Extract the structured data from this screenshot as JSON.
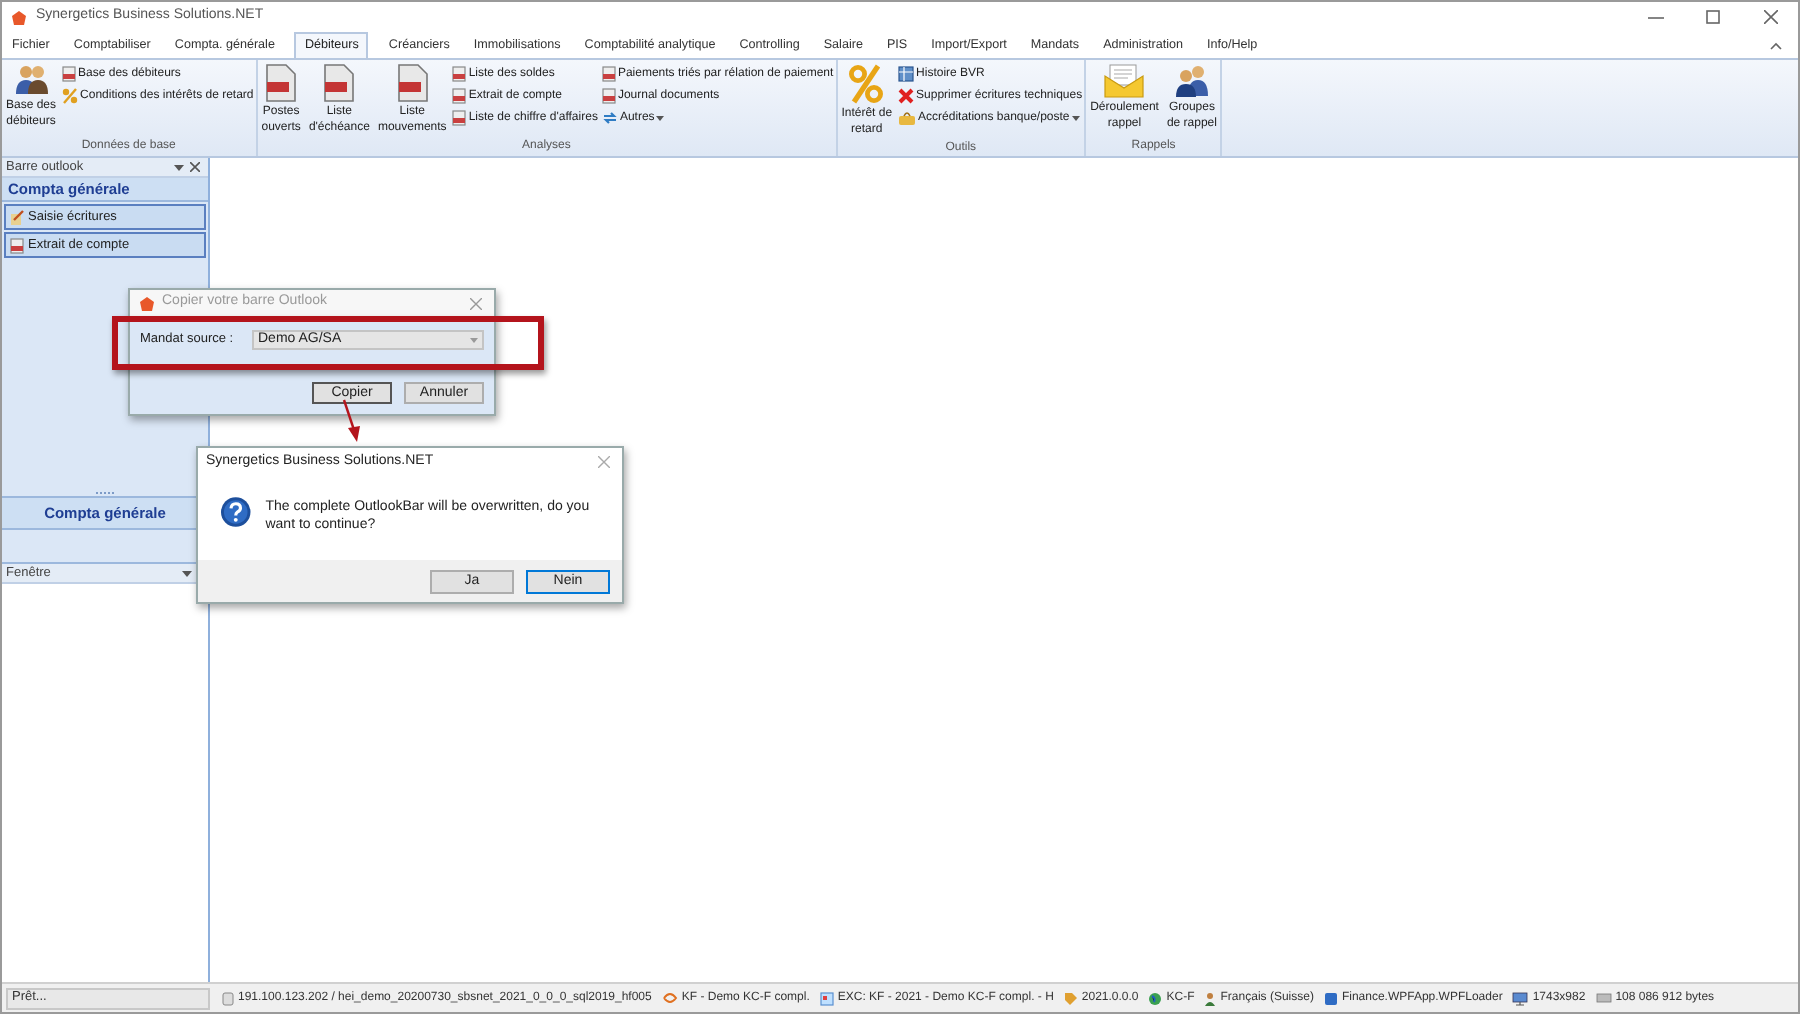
{
  "window": {
    "title": "Synergetics Business Solutions.NET"
  },
  "tabs": [
    {
      "label": "Fichier",
      "selected": false
    },
    {
      "label": "Comptabiliser",
      "selected": false
    },
    {
      "label": "Compta. générale",
      "selected": false
    },
    {
      "label": "Débiteurs",
      "selected": true
    },
    {
      "label": "Créanciers",
      "selected": false
    },
    {
      "label": "Immobilisations",
      "selected": false
    },
    {
      "label": "Comptabilité analytique",
      "selected": false
    },
    {
      "label": "Controlling",
      "selected": false
    },
    {
      "label": "Salaire",
      "selected": false
    },
    {
      "label": "PIS",
      "selected": false
    },
    {
      "label": "Import/Export",
      "selected": false
    },
    {
      "label": "Mandats",
      "selected": false
    },
    {
      "label": "Administration",
      "selected": false
    },
    {
      "label": "Info/Help",
      "selected": false
    }
  ],
  "ribbon": {
    "groups": [
      {
        "label": "Données de base",
        "buttons": [
          {
            "label": "Base des\ndébiteurs"
          }
        ],
        "columns": [
          [
            {
              "label": "Base des débiteurs",
              "dropdown": false
            },
            {
              "label": "Conditions des intérêts de retard",
              "dropdown": false
            }
          ]
        ]
      },
      {
        "label": "Analyses",
        "buttons": [
          {
            "label": "Postes\nouverts"
          },
          {
            "label": "Liste\nd'échéance"
          },
          {
            "label": "Liste\nmouvements"
          }
        ],
        "columns": [
          [
            {
              "label": "Liste des soldes",
              "dropdown": false
            },
            {
              "label": "Extrait de compte",
              "dropdown": false
            },
            {
              "label": "Liste de chiffre d'affaires",
              "dropdown": false
            }
          ],
          [
            {
              "label": "Paiements triés par rélation de paiement",
              "dropdown": false
            },
            {
              "label": "Journal documents",
              "dropdown": false
            },
            {
              "label": "Autres",
              "dropdown": true
            }
          ]
        ]
      },
      {
        "label": "Outils",
        "buttons": [
          {
            "label": "Intérêt de\nretard"
          }
        ],
        "columns": [
          [
            {
              "label": "Histoire BVR",
              "dropdown": false
            },
            {
              "label": "Supprimer écritures techniques",
              "dropdown": false
            },
            {
              "label": "Accréditations banque/poste",
              "dropdown": true
            }
          ]
        ]
      },
      {
        "label": "Rappels",
        "buttons": [
          {
            "label": "Déroulement\nrappel"
          },
          {
            "label": "Groupes\nde rappel"
          }
        ]
      }
    ]
  },
  "outlook_bar": {
    "title": "Barre outlook",
    "section": "Compta générale",
    "items": [
      {
        "label": "Saisie écritures"
      },
      {
        "label": "Extrait de compte"
      }
    ],
    "nav_button": "Compta générale",
    "window_section": "Fenêtre"
  },
  "copy_dialog": {
    "title": "Copier votre barre Outlook",
    "field_label": "Mandat source :",
    "value": "Demo AG/SA",
    "buttons": [
      {
        "label": "Copier",
        "default": true
      },
      {
        "label": "Annuler",
        "default": false
      }
    ]
  },
  "confirm_dialog": {
    "title": "Synergetics Business Solutions.NET",
    "message": "The complete OutlookBar will be overwritten, do you want to continue?",
    "buttons": [
      {
        "label": "Ja",
        "default": false
      },
      {
        "label": "Nein",
        "default": true
      }
    ]
  },
  "status_bar": {
    "status": "Prêt...",
    "items": [
      {
        "text": "191.100.123.202 / hei_demo_20200730_sbsnet_2021_0_0_0_sql2019_hf005"
      },
      {
        "text": "KF - Demo KC-F compl."
      },
      {
        "text": "EXC: KF - 2021 - Demo KC-F compl. - H"
      },
      {
        "text": "2021.0.0.0"
      },
      {
        "text": "KC-F"
      },
      {
        "text": "Français (Suisse)"
      },
      {
        "text": "Finance.WPFApp.WPFLoader"
      },
      {
        "text": "1743x982"
      },
      {
        "text": "108 086 912 bytes"
      }
    ]
  }
}
